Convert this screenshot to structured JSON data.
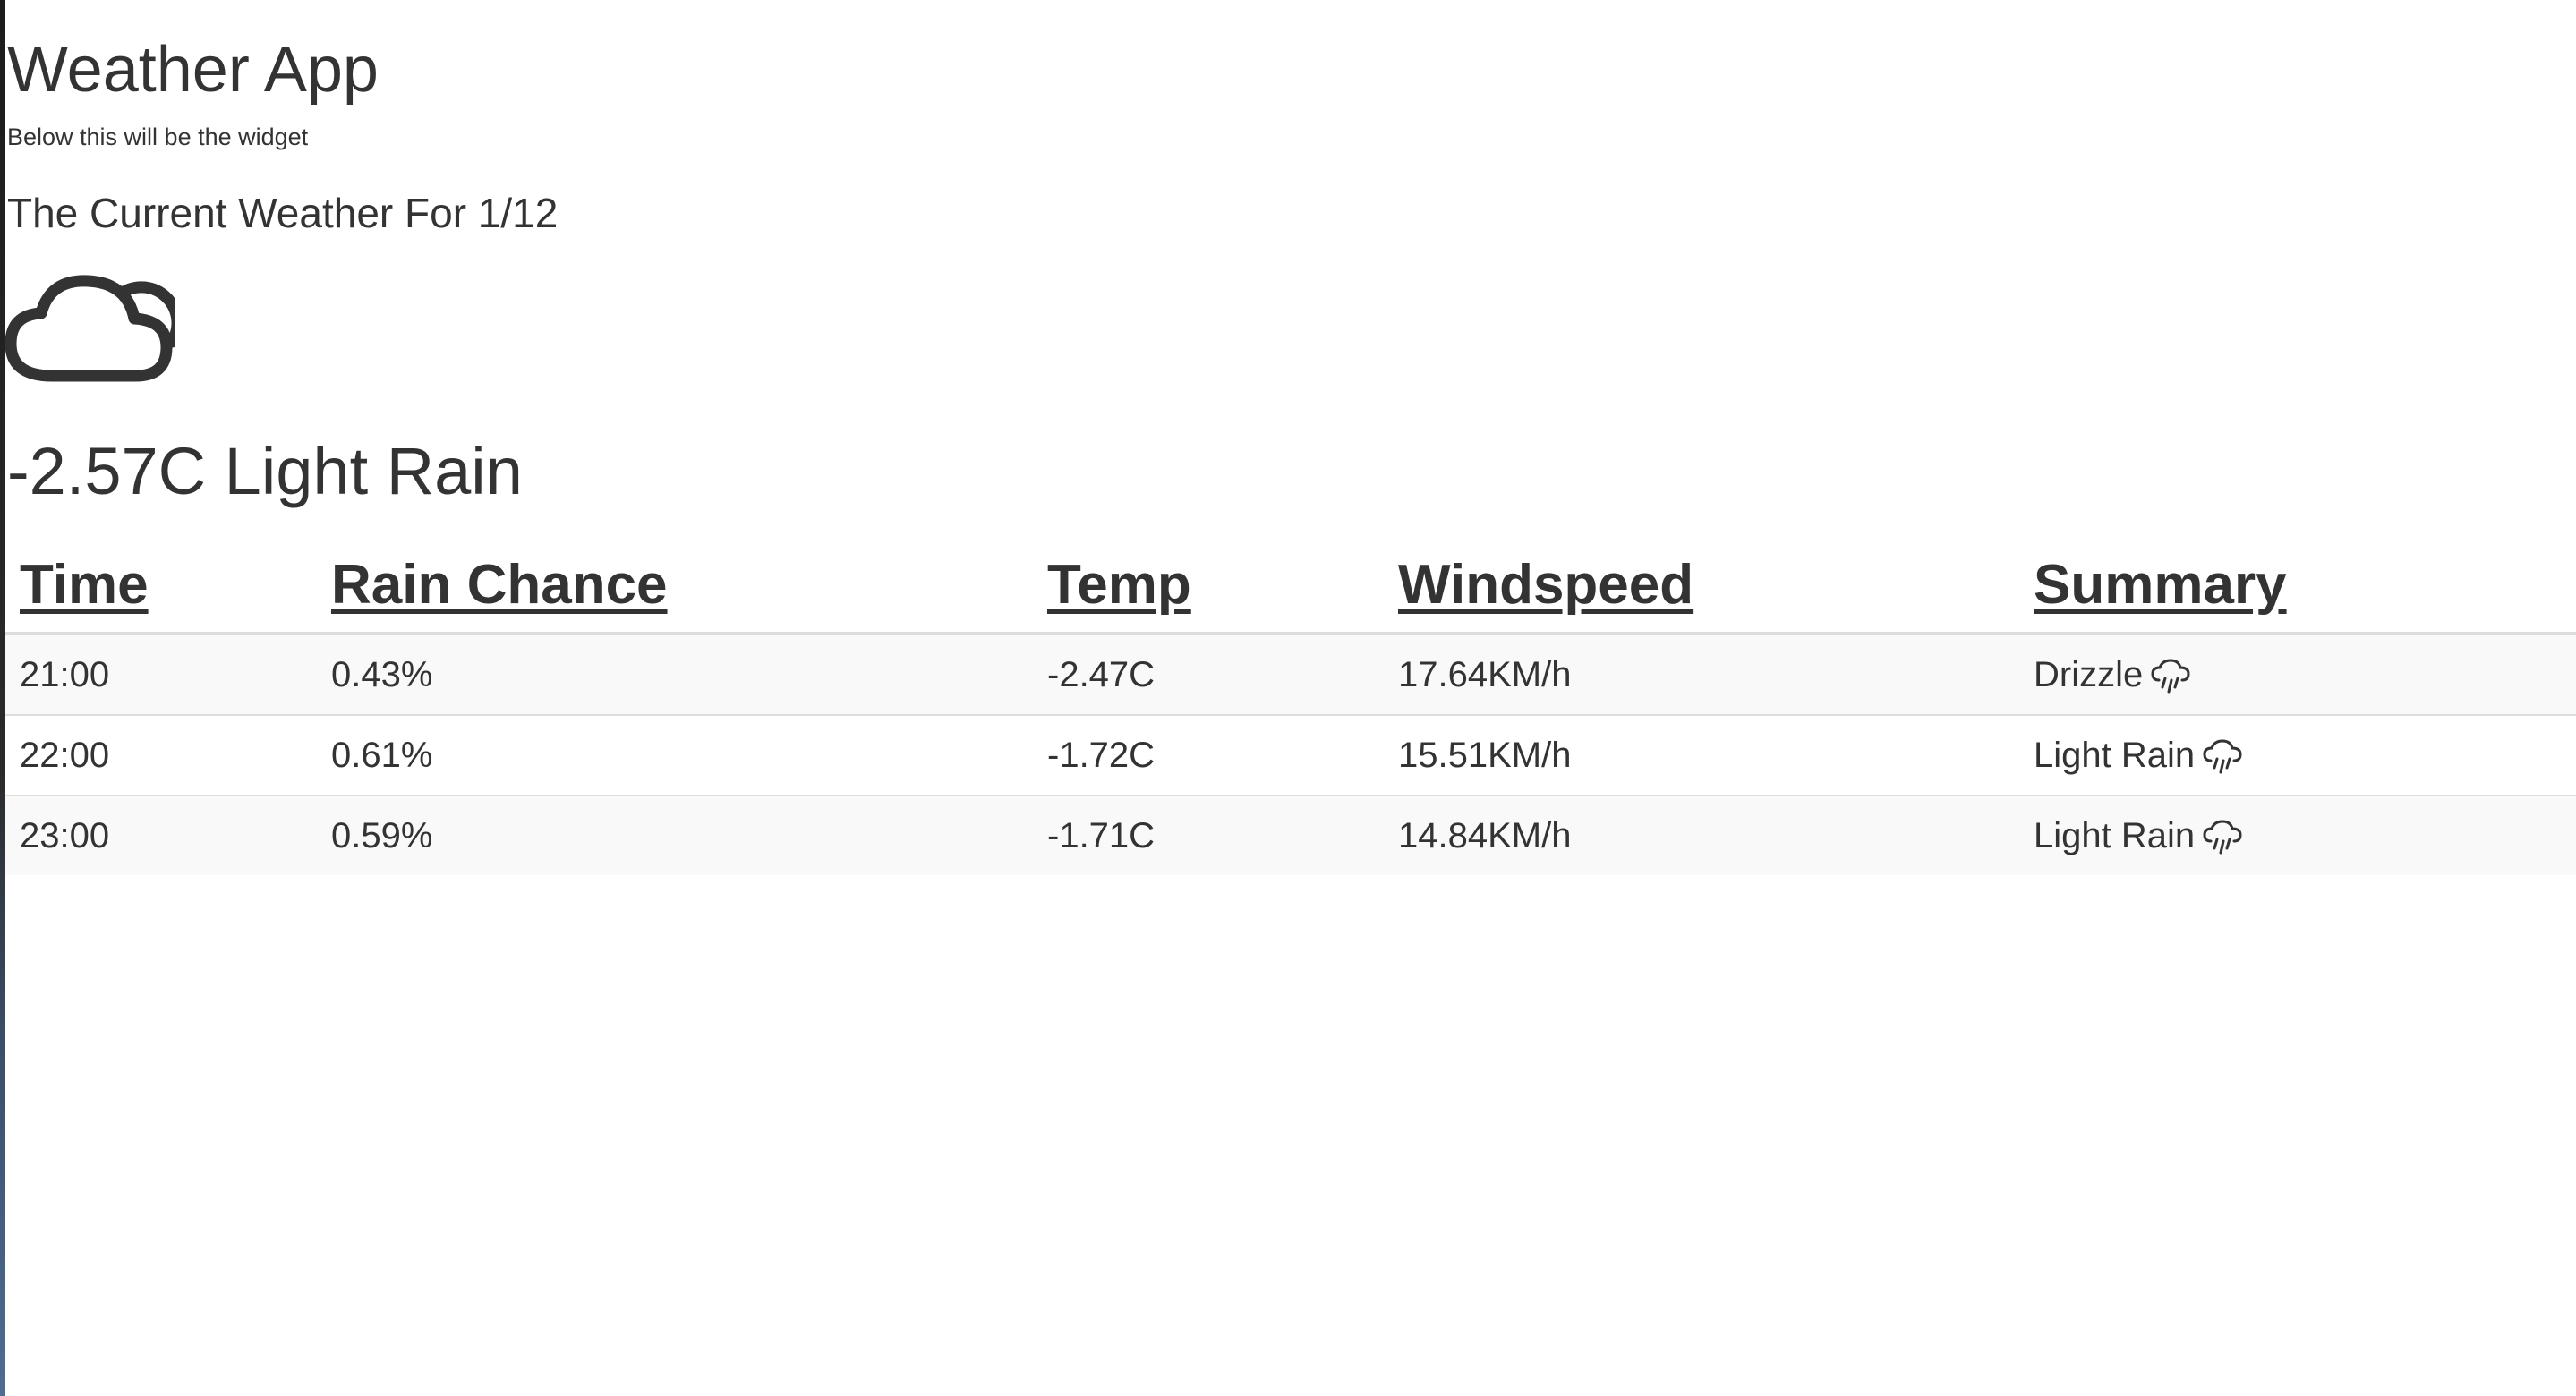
{
  "app": {
    "title": "Weather App",
    "subtext": "Below this will be the widget"
  },
  "current": {
    "heading": "The Current Weather For 1/12",
    "icon": "partly-cloudy-icon",
    "summary": "-2.57C Light Rain"
  },
  "forecast": {
    "columns": [
      "Time",
      "Rain Chance",
      "Temp",
      "Windspeed",
      "Summary"
    ],
    "rows": [
      {
        "time": "21:00",
        "rain_chance": "0.43%",
        "temp": "-2.47C",
        "windspeed": "17.64KM/h",
        "summary": "Drizzle",
        "icon": "rain-icon"
      },
      {
        "time": "22:00",
        "rain_chance": "0.61%",
        "temp": "-1.72C",
        "windspeed": "15.51KM/h",
        "summary": "Light Rain",
        "icon": "rain-icon"
      },
      {
        "time": "23:00",
        "rain_chance": "0.59%",
        "temp": "-1.71C",
        "windspeed": "14.84KM/h",
        "summary": "Light Rain",
        "icon": "rain-icon"
      }
    ]
  },
  "colors": {
    "text": "#333333",
    "row_stripe": "#f9f9f9",
    "border": "#dddddd"
  }
}
